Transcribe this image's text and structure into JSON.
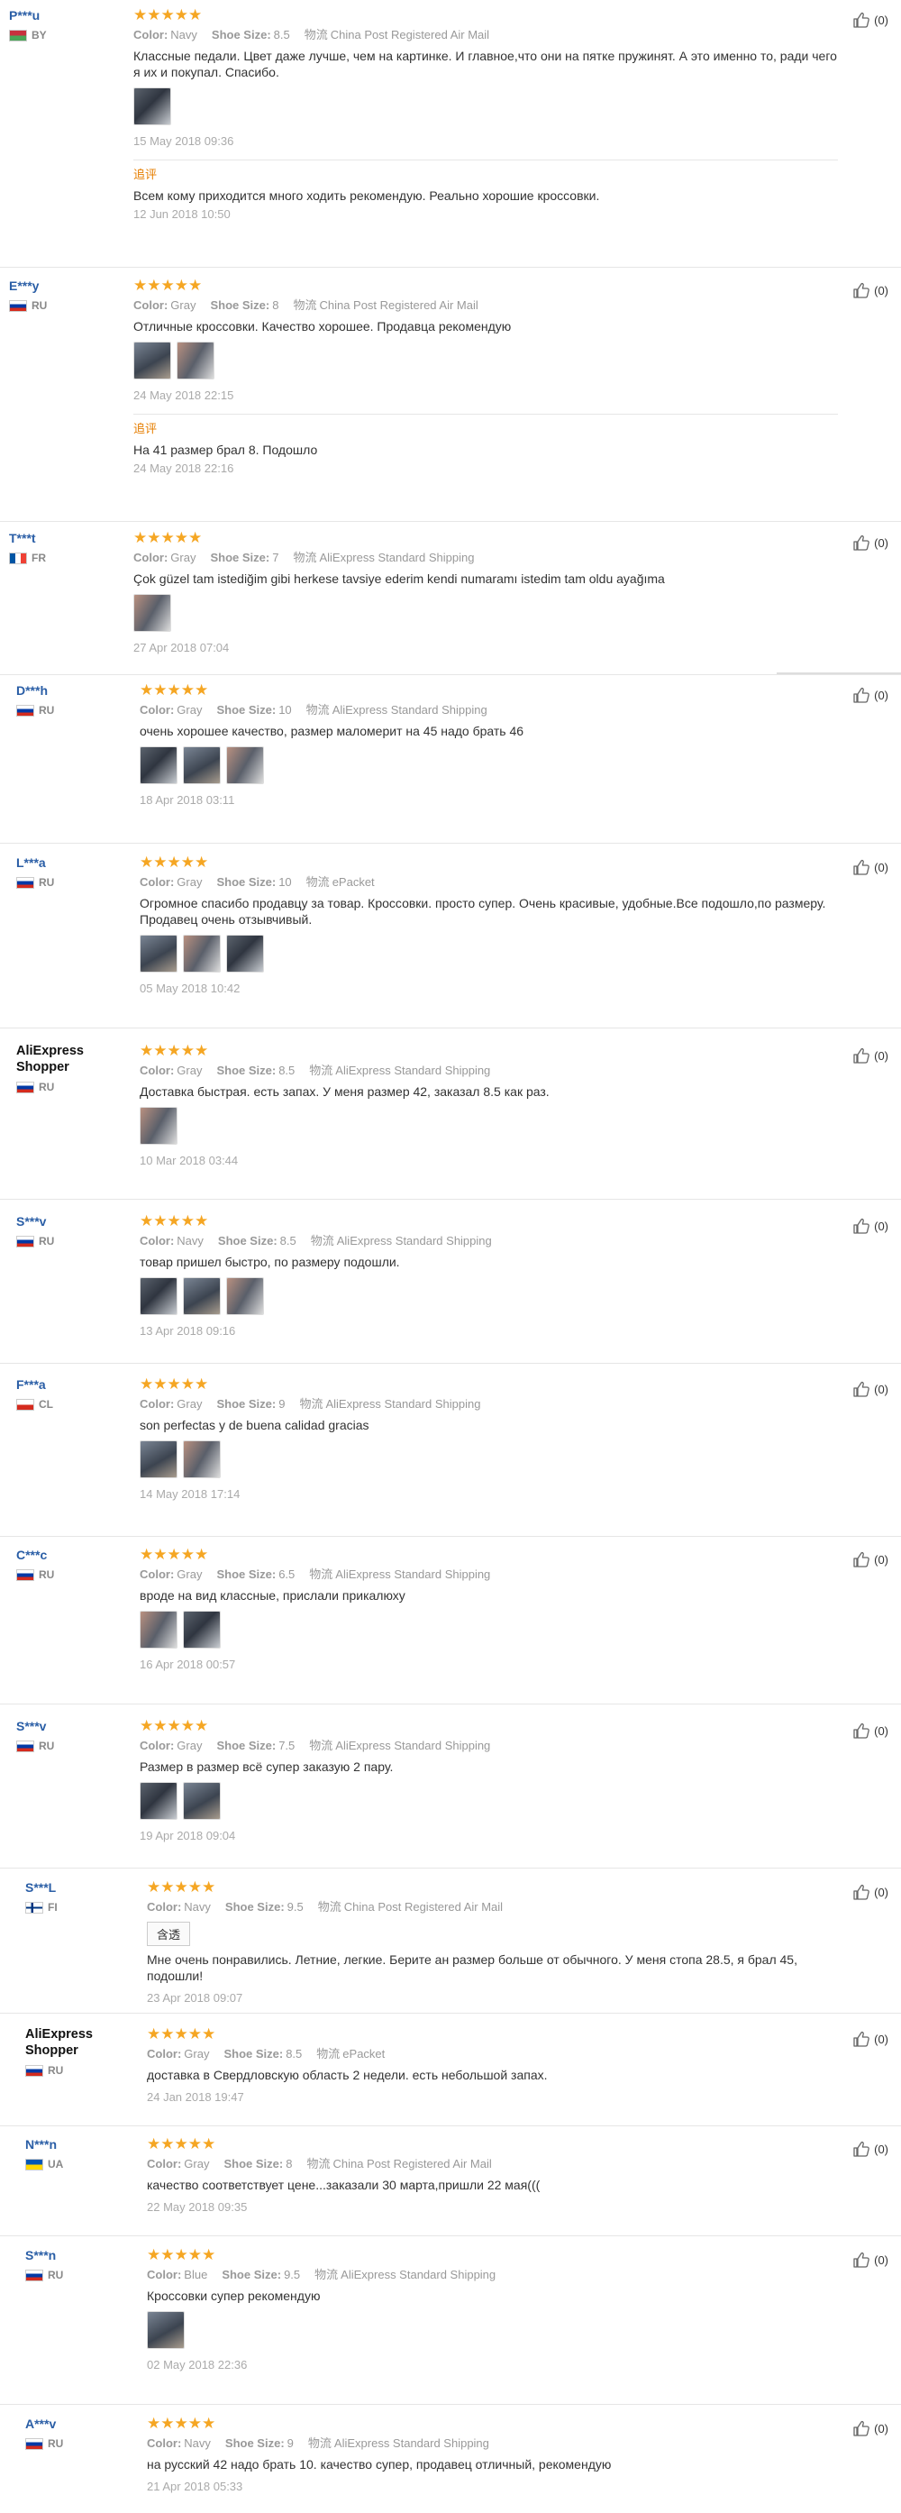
{
  "helpful_label": "(0)",
  "additional_label": "追评",
  "translate_label": "含透",
  "meta_labels": {
    "color": "Color:",
    "size": "Shoe Size:",
    "shipping": "物流"
  },
  "reviews": [
    {
      "user": "P***u",
      "country": "BY",
      "flag": [
        "#c8313e",
        "#4aa657"
      ],
      "color": "Navy",
      "size": "8.5",
      "shipping": "China Post Registered Air Mail",
      "text": "Классные педали. Цвет даже лучше, чем на картинке. И главное,что они на пятке пружинят. А это именно то, ради чего я их и покупал. Спасибо.",
      "date": "15 May 2018 09:36",
      "photos": 1,
      "additional": {
        "text": "Всем кому приходится много ходить рекомендую. Реально хорошие кроссовки.",
        "date": "12 Jun 2018 10:50"
      }
    },
    {
      "user": "E***y",
      "country": "RU",
      "flag": [
        "#ffffff",
        "#0039a6",
        "#d52b1e"
      ],
      "color": "Gray",
      "size": "8",
      "shipping": "China Post Registered Air Mail",
      "text": "Отличные кроссовки. Качество хорошее. Продавца рекомендую",
      "date": "24 May 2018 22:15",
      "photos": 2,
      "additional": {
        "text": "На 41 размер брал 8. Подошло",
        "date": "24 May 2018 22:16"
      }
    },
    {
      "user": "T***t",
      "country": "FR",
      "flag": [
        "#0055a4",
        "#ffffff",
        "#ef4135"
      ],
      "color": "Gray",
      "size": "7",
      "shipping": "AliExpress Standard Shipping",
      "text": "Çok güzel tam istediğim gibi herkese tavsiye ederim kendi numaramı istedim tam oldu ayağıma",
      "date": "27 Apr 2018 07:04",
      "photos": 1
    },
    {
      "user": "D***h",
      "country": "RU",
      "flag": [
        "#ffffff",
        "#0039a6",
        "#d52b1e"
      ],
      "color": "Gray",
      "size": "10",
      "shipping": "AliExpress Standard Shipping",
      "text": "очень хорошее качество, размер маломерит на 45 надо брать 46",
      "date": "18 Apr 2018 03:11",
      "photos": 3
    },
    {
      "user": "L***a",
      "country": "RU",
      "flag": [
        "#ffffff",
        "#0039a6",
        "#d52b1e"
      ],
      "color": "Gray",
      "size": "10",
      "shipping": "ePacket",
      "text": "Огромное спасибо продавцу за товар. Кроссовки. просто супер. Очень красивые, удобные.Все подошло,по размеру. Продавец очень отзывчивый.",
      "date": "05 May 2018 10:42",
      "photos": 3
    },
    {
      "user": "AliExpress Shopper",
      "country": "RU",
      "flag": [
        "#ffffff",
        "#0039a6",
        "#d52b1e"
      ],
      "color": "Gray",
      "size": "8.5",
      "shipping": "AliExpress Standard Shipping",
      "text": "Доставка быстрая. есть запах. У меня размер 42, заказал 8.5 как раз.",
      "date": "10 Mar 2018 03:44",
      "photos": 1
    },
    {
      "user": "S***v",
      "country": "RU",
      "flag": [
        "#ffffff",
        "#0039a6",
        "#d52b1e"
      ],
      "color": "Navy",
      "size": "8.5",
      "shipping": "AliExpress Standard Shipping",
      "text": "товар пришел быстро, по размеру подошли.",
      "date": "13 Apr 2018 09:16",
      "photos": 3
    },
    {
      "user": "F***a",
      "country": "CL",
      "flag": [
        "#ffffff",
        "#d52b1e",
        "#0039a6"
      ],
      "color": "Gray",
      "size": "9",
      "shipping": "AliExpress Standard Shipping",
      "text": "son perfectas y de buena calidad gracias",
      "date": "14 May 2018 17:14",
      "photos": 2
    },
    {
      "user": "C***c",
      "country": "RU",
      "flag": [
        "#ffffff",
        "#0039a6",
        "#d52b1e"
      ],
      "color": "Gray",
      "size": "6.5",
      "shipping": "AliExpress Standard Shipping",
      "text": "вроде на вид классные, прислали прикалюху",
      "date": "16 Apr 2018 00:57",
      "photos": 2
    },
    {
      "user": "S***v",
      "country": "RU",
      "flag": [
        "#ffffff",
        "#0039a6",
        "#d52b1e"
      ],
      "color": "Gray",
      "size": "7.5",
      "shipping": "AliExpress Standard Shipping",
      "text": "Размер в размер всё супер заказую 2 пару.",
      "date": "19 Apr 2018 09:04",
      "photos": 2
    },
    {
      "user": "S***L",
      "country": "FI",
      "flag": [
        "#ffffff",
        "#003580",
        "#ffffff"
      ],
      "color": "Navy",
      "size": "9.5",
      "shipping": "China Post Registered Air Mail",
      "text": "Мне очень понравились. Летние, легкие. Берите ан размер больше от обычного. У меня стопа 28.5, я брал 45, подошли!",
      "date": "23 Apr 2018 09:07",
      "photos": 0,
      "translate": true
    },
    {
      "user": "AliExpress Shopper",
      "country": "RU",
      "flag": [
        "#ffffff",
        "#0039a6",
        "#d52b1e"
      ],
      "color": "Gray",
      "size": "8.5",
      "shipping": "ePacket",
      "text": "доставка в Свердловскую область 2 недели. есть небольшой запах.",
      "date": "24 Jan 2018 19:47",
      "photos": 0
    },
    {
      "user": "N***n",
      "country": "UA",
      "flag": [
        "#0057b7",
        "#ffd700"
      ],
      "color": "Gray",
      "size": "8",
      "shipping": "China Post Registered Air Mail",
      "text": "качество соответствует цене...заказали 30 марта,пришли 22 мая(((",
      "date": "22 May 2018 09:35",
      "photos": 0
    },
    {
      "user": "S***n",
      "country": "RU",
      "flag": [
        "#ffffff",
        "#0039a6",
        "#d52b1e"
      ],
      "color": "Blue",
      "size": "9.5",
      "shipping": "AliExpress Standard Shipping",
      "text": "Кроссовки супер рекомендую",
      "date": "02 May 2018 22:36",
      "photos": 1
    },
    {
      "user": "A***v",
      "country": "RU",
      "flag": [
        "#ffffff",
        "#0039a6",
        "#d52b1e"
      ],
      "color": "Navy",
      "size": "9",
      "shipping": "AliExpress Standard Shipping",
      "text": "на русский 42 надо брать 10. качество супер, продавец отличный, рекомендую",
      "date": "21 Apr 2018 05:33",
      "photos": 0
    }
  ]
}
